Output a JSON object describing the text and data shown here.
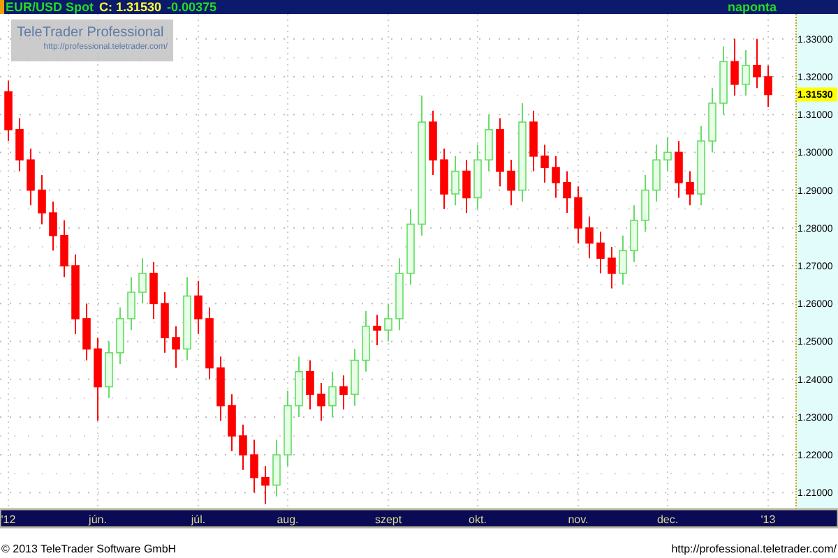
{
  "header": {
    "symbol": "EUR/USD Spot",
    "close": "C: 1.31530",
    "change": "-0.00375",
    "interval": "naponta"
  },
  "chart": {
    "logo": {
      "title": "TeleTrader Professional",
      "url": "http://professional.teletrader.com/"
    },
    "current_price": "1.31530",
    "chart_data": {
      "type": "candlestick",
      "categories": [
        "'12",
        null,
        null,
        null,
        null,
        null,
        null,
        null,
        "jún.",
        null,
        null,
        null,
        null,
        null,
        null,
        null,
        null,
        "júl.",
        null,
        null,
        null,
        null,
        null,
        null,
        null,
        "aug.",
        null,
        null,
        null,
        null,
        null,
        null,
        null,
        null,
        "szept",
        null,
        null,
        null,
        null,
        null,
        null,
        null,
        "okt.",
        null,
        null,
        null,
        null,
        null,
        null,
        null,
        null,
        "nov.",
        null,
        null,
        null,
        null,
        null,
        null,
        null,
        "dec.",
        null,
        null,
        null,
        null,
        null,
        null,
        null,
        null,
        "'13"
      ],
      "ohlc": [
        [
          1.316,
          1.319,
          1.303,
          1.306
        ],
        [
          1.306,
          1.309,
          1.295,
          1.298
        ],
        [
          1.298,
          1.301,
          1.286,
          1.29
        ],
        [
          1.29,
          1.294,
          1.281,
          1.284
        ],
        [
          1.284,
          1.287,
          1.274,
          1.278
        ],
        [
          1.278,
          1.282,
          1.267,
          1.27
        ],
        [
          1.27,
          1.273,
          1.252,
          1.256
        ],
        [
          1.256,
          1.26,
          1.245,
          1.248
        ],
        [
          1.248,
          1.251,
          1.229,
          1.238
        ],
        [
          1.238,
          1.25,
          1.235,
          1.247
        ],
        [
          1.247,
          1.259,
          1.244,
          1.256
        ],
        [
          1.256,
          1.267,
          1.253,
          1.263
        ],
        [
          1.263,
          1.272,
          1.26,
          1.268
        ],
        [
          1.268,
          1.271,
          1.256,
          1.26
        ],
        [
          1.26,
          1.263,
          1.247,
          1.251
        ],
        [
          1.251,
          1.254,
          1.243,
          1.248
        ],
        [
          1.248,
          1.267,
          1.245,
          1.262
        ],
        [
          1.262,
          1.266,
          1.252,
          1.256
        ],
        [
          1.256,
          1.259,
          1.24,
          1.243
        ],
        [
          1.243,
          1.246,
          1.229,
          1.233
        ],
        [
          1.233,
          1.236,
          1.221,
          1.225
        ],
        [
          1.225,
          1.228,
          1.216,
          1.22
        ],
        [
          1.22,
          1.224,
          1.21,
          1.214
        ],
        [
          1.214,
          1.217,
          1.207,
          1.212
        ],
        [
          1.212,
          1.224,
          1.209,
          1.22
        ],
        [
          1.22,
          1.237,
          1.217,
          1.233
        ],
        [
          1.233,
          1.246,
          1.23,
          1.242
        ],
        [
          1.242,
          1.245,
          1.232,
          1.236
        ],
        [
          1.236,
          1.239,
          1.229,
          1.233
        ],
        [
          1.233,
          1.242,
          1.23,
          1.238
        ],
        [
          1.238,
          1.241,
          1.232,
          1.236
        ],
        [
          1.236,
          1.248,
          1.233,
          1.245
        ],
        [
          1.245,
          1.258,
          1.242,
          1.254
        ],
        [
          1.254,
          1.257,
          1.249,
          1.253
        ],
        [
          1.253,
          1.26,
          1.25,
          1.256
        ],
        [
          1.256,
          1.272,
          1.253,
          1.268
        ],
        [
          1.268,
          1.285,
          1.265,
          1.281
        ],
        [
          1.281,
          1.315,
          1.278,
          1.308
        ],
        [
          1.308,
          1.311,
          1.294,
          1.298
        ],
        [
          1.298,
          1.301,
          1.285,
          1.289
        ],
        [
          1.289,
          1.299,
          1.286,
          1.295
        ],
        [
          1.295,
          1.298,
          1.284,
          1.288
        ],
        [
          1.288,
          1.302,
          1.285,
          1.298
        ],
        [
          1.298,
          1.31,
          1.295,
          1.306
        ],
        [
          1.306,
          1.309,
          1.291,
          1.295
        ],
        [
          1.295,
          1.298,
          1.286,
          1.29
        ],
        [
          1.29,
          1.313,
          1.287,
          1.308
        ],
        [
          1.308,
          1.311,
          1.295,
          1.299
        ],
        [
          1.299,
          1.302,
          1.292,
          1.296
        ],
        [
          1.296,
          1.299,
          1.288,
          1.292
        ],
        [
          1.292,
          1.295,
          1.284,
          1.288
        ],
        [
          1.288,
          1.291,
          1.276,
          1.28
        ],
        [
          1.28,
          1.283,
          1.272,
          1.276
        ],
        [
          1.276,
          1.279,
          1.268,
          1.272
        ],
        [
          1.272,
          1.275,
          1.264,
          1.268
        ],
        [
          1.268,
          1.278,
          1.265,
          1.274
        ],
        [
          1.274,
          1.286,
          1.271,
          1.282
        ],
        [
          1.282,
          1.294,
          1.279,
          1.29
        ],
        [
          1.29,
          1.302,
          1.287,
          1.298
        ],
        [
          1.298,
          1.304,
          1.295,
          1.3
        ],
        [
          1.3,
          1.303,
          1.288,
          1.292
        ],
        [
          1.292,
          1.295,
          1.286,
          1.289
        ],
        [
          1.289,
          1.307,
          1.286,
          1.303
        ],
        [
          1.303,
          1.317,
          1.3,
          1.313
        ],
        [
          1.313,
          1.328,
          1.31,
          1.324
        ],
        [
          1.324,
          1.33,
          1.315,
          1.318
        ],
        [
          1.318,
          1.327,
          1.315,
          1.323
        ],
        [
          1.323,
          1.33,
          1.317,
          1.32
        ],
        [
          1.32,
          1.323,
          1.312,
          1.3153
        ]
      ],
      "ylim": [
        1.206,
        1.3366
      ],
      "grid": true,
      "yticks": [
        {
          "value": 1.33,
          "label": "1.33000"
        },
        {
          "value": 1.32,
          "label": "1.32000"
        },
        {
          "value": 1.31,
          "label": "1.31000"
        },
        {
          "value": 1.3,
          "label": "1.30000"
        },
        {
          "value": 1.29,
          "label": "1.29000"
        },
        {
          "value": 1.28,
          "label": "1.28000"
        },
        {
          "value": 1.27,
          "label": "1.27000"
        },
        {
          "value": 1.26,
          "label": "1.26000"
        },
        {
          "value": 1.25,
          "label": "1.25000"
        },
        {
          "value": 1.24,
          "label": "1.24000"
        },
        {
          "value": 1.23,
          "label": "1.23000"
        },
        {
          "value": 1.22,
          "label": "1.22000"
        },
        {
          "value": 1.21,
          "label": "1.21000"
        }
      ]
    }
  },
  "footer": {
    "copyright": "© 2013 TeleTrader Software GmbH",
    "url": "http://professional.teletrader.com/"
  }
}
